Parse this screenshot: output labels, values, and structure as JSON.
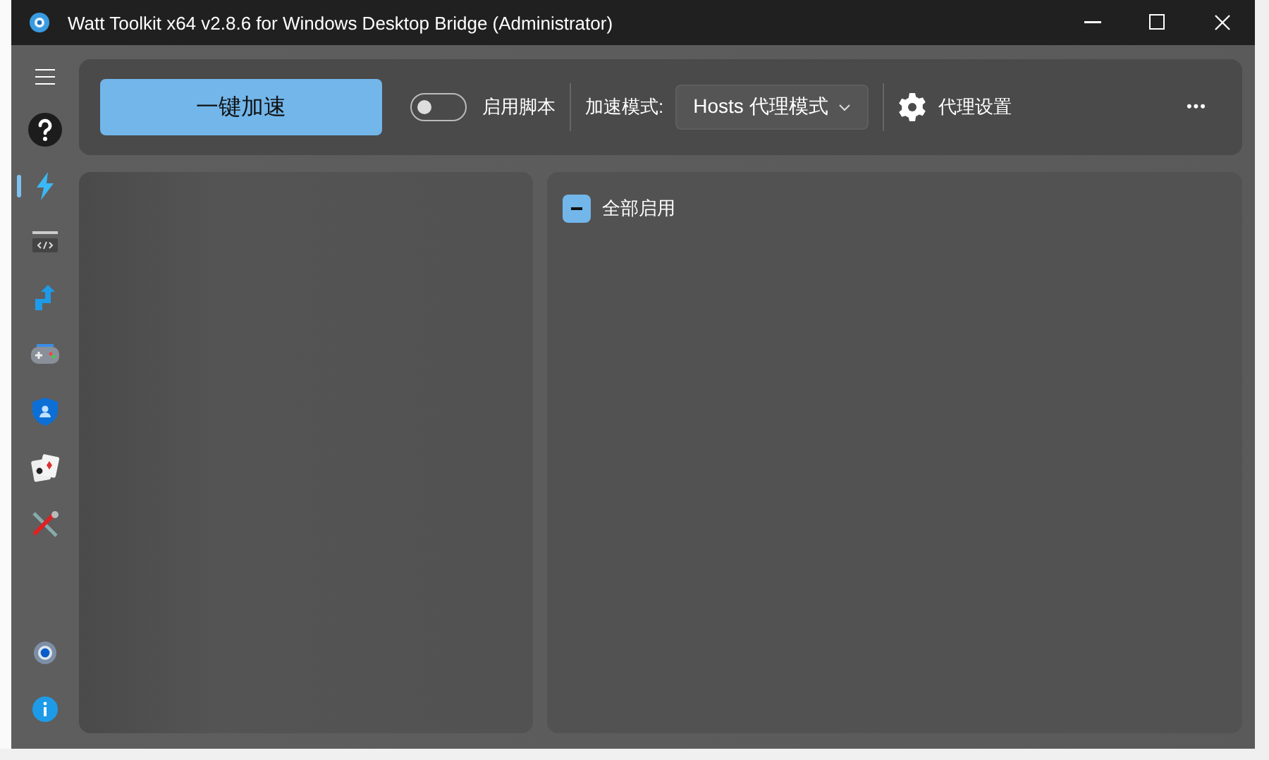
{
  "window": {
    "title": "Watt Toolkit x64 v2.8.6 for Windows Desktop Bridge (Administrator)"
  },
  "sidebar": {
    "items": [
      {
        "selected": false
      },
      {
        "selected": true
      },
      {
        "selected": false
      },
      {
        "selected": false
      },
      {
        "selected": false
      },
      {
        "selected": false
      },
      {
        "selected": false
      },
      {
        "selected": false
      }
    ],
    "bottom_items": [
      {
        "selected": false
      },
      {
        "selected": false
      }
    ]
  },
  "toolbar": {
    "accelerate_button": "一键加速",
    "script_toggle": {
      "label": "启用脚本",
      "on": false
    },
    "mode_label": "加速模式:",
    "mode_dropdown": "Hosts 代理模式",
    "proxy_settings": "代理设置",
    "more": "•••"
  },
  "services": {
    "select_all": {
      "label": "全部启用",
      "indeterminate": true
    }
  }
}
